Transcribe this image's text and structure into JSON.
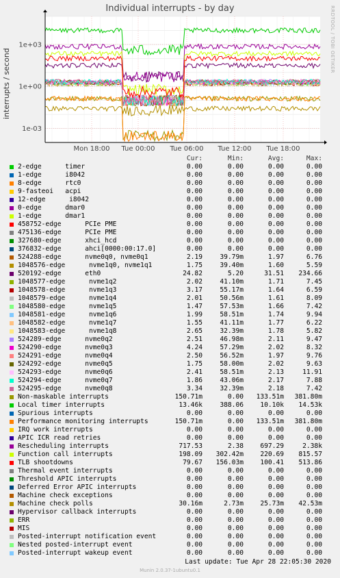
{
  "chart_data": {
    "type": "line",
    "title": "Individual interrupts - by day",
    "ylabel": "interrupts / second",
    "y_scale": "log",
    "ylim": [
      0.0001,
      100000
    ],
    "y_ticks": [
      "1e+03",
      "1e+00",
      "1e-03"
    ],
    "x_ticks": [
      "Mon 18:00",
      "Tue 00:00",
      "Tue 06:00",
      "Tue 12:00",
      "Tue 18:00"
    ],
    "grid": true,
    "columns": [
      "Cur:",
      "Min:",
      "Avg:",
      "Max:"
    ],
    "series": [
      {
        "name": "2-edge      timer",
        "color": "#00cc00",
        "cur": "0.00",
        "min": "0.00",
        "avg": "0.00",
        "max": "0.00"
      },
      {
        "name": "1-edge      i8042",
        "color": "#0066b3",
        "cur": "0.00",
        "min": "0.00",
        "avg": "0.00",
        "max": "0.00"
      },
      {
        "name": "8-edge      rtc0",
        "color": "#ff8000",
        "cur": "0.00",
        "min": "0.00",
        "avg": "0.00",
        "max": "0.00"
      },
      {
        "name": "9-fasteoi   acpi",
        "color": "#ffcc00",
        "cur": "0.00",
        "min": "0.00",
        "avg": "0.00",
        "max": "0.00"
      },
      {
        "name": "12-edge      i8042",
        "color": "#330099",
        "cur": "0.00",
        "min": "0.00",
        "avg": "0.00",
        "max": "0.00"
      },
      {
        "name": "0-edge      dmar0",
        "color": "#990099",
        "cur": "0.00",
        "min": "0.00",
        "avg": "0.00",
        "max": "0.00"
      },
      {
        "name": "1-edge      dmar1",
        "color": "#ccff00",
        "cur": "0.00",
        "min": "0.00",
        "avg": "0.00",
        "max": "0.00"
      },
      {
        "name": "458752-edge      PCIe PME",
        "color": "#ff0000",
        "cur": "0.00",
        "min": "0.00",
        "avg": "0.00",
        "max": "0.00"
      },
      {
        "name": "475136-edge      PCIe PME",
        "color": "#808080",
        "cur": "0.00",
        "min": "0.00",
        "avg": "0.00",
        "max": "0.00"
      },
      {
        "name": "327680-edge      xhci_hcd",
        "color": "#008f00",
        "cur": "0.00",
        "min": "0.00",
        "avg": "0.00",
        "max": "0.00"
      },
      {
        "name": "376832-edge      ahci[0000:00:17.0]",
        "color": "#00487d",
        "cur": "0.00",
        "min": "0.00",
        "avg": "0.00",
        "max": "0.00"
      },
      {
        "name": "524288-edge      nvme0q0, nvme0q1",
        "color": "#b35a00",
        "cur": "2.19",
        "min": "39.79m",
        "avg": "1.97",
        "max": "6.76"
      },
      {
        "name": "1048576-edge      nvme1q0, nvme1q1",
        "color": "#b38f00",
        "cur": "1.75",
        "min": "39.40m",
        "avg": "1.60",
        "max": "5.59"
      },
      {
        "name": "520192-edge      eth0",
        "color": "#6b006b",
        "cur": "24.82",
        "min": "5.20",
        "avg": "31.51",
        "max": "234.66"
      },
      {
        "name": "1048577-edge      nvme1q2",
        "color": "#8fb300",
        "cur": "2.02",
        "min": "41.10m",
        "avg": "1.71",
        "max": "7.45"
      },
      {
        "name": "1048578-edge      nvme1q3",
        "color": "#b30000",
        "cur": "3.17",
        "min": "55.17m",
        "avg": "1.64",
        "max": "6.59"
      },
      {
        "name": "1048579-edge      nvme1q4",
        "color": "#bebebe",
        "cur": "2.01",
        "min": "50.56m",
        "avg": "1.61",
        "max": "8.09"
      },
      {
        "name": "1048580-edge      nvme1q5",
        "color": "#80ff80",
        "cur": "1.47",
        "min": "57.53m",
        "avg": "1.66",
        "max": "7.42"
      },
      {
        "name": "1048581-edge      nvme1q6",
        "color": "#80c9ff",
        "cur": "1.99",
        "min": "58.51m",
        "avg": "1.74",
        "max": "9.94"
      },
      {
        "name": "1048582-edge      nvme1q7",
        "color": "#ffc080",
        "cur": "1.55",
        "min": "41.11m",
        "avg": "1.77",
        "max": "6.22"
      },
      {
        "name": "1048583-edge      nvme1q8",
        "color": "#ffe680",
        "cur": "2.65",
        "min": "32.39m",
        "avg": "1.78",
        "max": "5.82"
      },
      {
        "name": "524289-edge      nvme0q2",
        "color": "#aa80ff",
        "cur": "2.51",
        "min": "46.98m",
        "avg": "2.11",
        "max": "9.47"
      },
      {
        "name": "524290-edge      nvme0q3",
        "color": "#ee00cc",
        "cur": "4.24",
        "min": "57.29m",
        "avg": "2.02",
        "max": "8.32"
      },
      {
        "name": "524291-edge      nvme0q4",
        "color": "#ff8080",
        "cur": "2.50",
        "min": "56.52m",
        "avg": "1.97",
        "max": "9.76"
      },
      {
        "name": "524292-edge      nvme0q5",
        "color": "#666600",
        "cur": "1.75",
        "min": "58.00m",
        "avg": "2.02",
        "max": "9.63"
      },
      {
        "name": "524293-edge      nvme0q6",
        "color": "#ffbfff",
        "cur": "2.41",
        "min": "58.51m",
        "avg": "2.13",
        "max": "11.91"
      },
      {
        "name": "524294-edge      nvme0q7",
        "color": "#00ffcc",
        "cur": "1.86",
        "min": "43.06m",
        "avg": "2.17",
        "max": "7.88"
      },
      {
        "name": "524295-edge      nvme0q8",
        "color": "#cc6699",
        "cur": "3.34",
        "min": "32.39m",
        "avg": "2.18",
        "max": "7.42"
      },
      {
        "name": "Non-maskable interrupts",
        "color": "#999900",
        "cur": "150.71m",
        "min": "0.00",
        "avg": "133.51m",
        "max": "381.80m"
      },
      {
        "name": "Local timer interrupts",
        "color": "#00cc00",
        "cur": "13.46k",
        "min": "388.06",
        "avg": "10.10k",
        "max": "14.53k"
      },
      {
        "name": "Spurious interrupts",
        "color": "#0066b3",
        "cur": "0.00",
        "min": "0.00",
        "avg": "0.00",
        "max": "0.00"
      },
      {
        "name": "Performance monitoring interrupts",
        "color": "#ff8000",
        "cur": "150.71m",
        "min": "0.00",
        "avg": "133.51m",
        "max": "381.80m"
      },
      {
        "name": "IRQ work interrupts",
        "color": "#ffcc00",
        "cur": "0.00",
        "min": "0.00",
        "avg": "0.00",
        "max": "0.00"
      },
      {
        "name": "APIC ICR read retries",
        "color": "#330099",
        "cur": "0.00",
        "min": "0.00",
        "avg": "0.00",
        "max": "0.00"
      },
      {
        "name": "Rescheduling interrupts",
        "color": "#990099",
        "cur": "717.53",
        "min": "2.38",
        "avg": "697.29",
        "max": "2.38k"
      },
      {
        "name": "Function call interrupts",
        "color": "#ccff00",
        "cur": "198.09",
        "min": "302.42m",
        "avg": "220.69",
        "max": "815.57"
      },
      {
        "name": "TLB shootdowns",
        "color": "#ff0000",
        "cur": "79.67",
        "min": "156.03m",
        "avg": "100.41",
        "max": "513.86"
      },
      {
        "name": "Thermal event interrupts",
        "color": "#808080",
        "cur": "0.00",
        "min": "0.00",
        "avg": "0.00",
        "max": "0.00"
      },
      {
        "name": "Threshold APIC interrupts",
        "color": "#008f00",
        "cur": "0.00",
        "min": "0.00",
        "avg": "0.00",
        "max": "0.00"
      },
      {
        "name": "Deferred Error APIC interrupts",
        "color": "#00487d",
        "cur": "0.00",
        "min": "0.00",
        "avg": "0.00",
        "max": "0.00"
      },
      {
        "name": "Machine check exceptions",
        "color": "#b35a00",
        "cur": "0.00",
        "min": "0.00",
        "avg": "0.00",
        "max": "0.00"
      },
      {
        "name": "Machine check polls",
        "color": "#b38f00",
        "cur": "30.16m",
        "min": "2.73m",
        "avg": "25.73m",
        "max": "42.53m"
      },
      {
        "name": "Hypervisor callback interrupts",
        "color": "#6b006b",
        "cur": "0.00",
        "min": "0.00",
        "avg": "0.00",
        "max": "0.00"
      },
      {
        "name": "ERR",
        "color": "#8fb300",
        "cur": "0.00",
        "min": "0.00",
        "avg": "0.00",
        "max": "0.00"
      },
      {
        "name": "MIS",
        "color": "#b30000",
        "cur": "0.00",
        "min": "0.00",
        "avg": "0.00",
        "max": "0.00"
      },
      {
        "name": "Posted-interrupt notification event",
        "color": "#bebebe",
        "cur": "0.00",
        "min": "0.00",
        "avg": "0.00",
        "max": "0.00"
      },
      {
        "name": "Nested posted-interrupt event",
        "color": "#80ff80",
        "cur": "0.00",
        "min": "0.00",
        "avg": "0.00",
        "max": "0.00"
      },
      {
        "name": "Posted-interrupt wakeup event",
        "color": "#80c9ff",
        "cur": "0.00",
        "min": "0.00",
        "avg": "0.00",
        "max": "0.00"
      }
    ]
  },
  "side_label": "RRDTOOL / TOBI OETIKER",
  "last_update": "Last update: Tue Apr 28 22:05:30 2020",
  "footer": "Munin 2.0.37-1ubuntu0.1"
}
